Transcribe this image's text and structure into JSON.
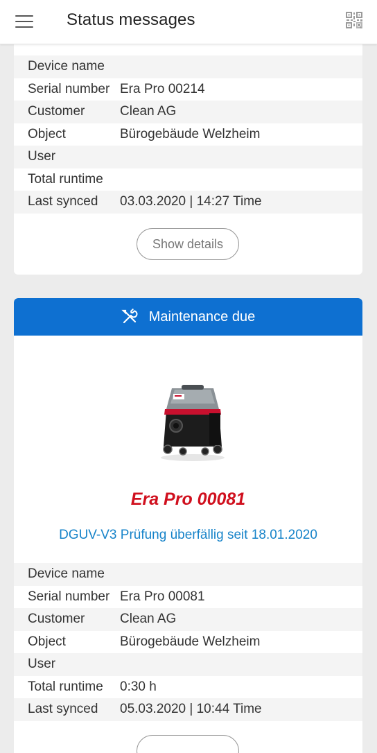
{
  "header": {
    "title": "Status messages",
    "menu_icon": "hamburger-menu-icon",
    "qr_icon": "qr-code-icon"
  },
  "card1": {
    "rows": [
      {
        "label": "Device name",
        "value": ""
      },
      {
        "label": "Serial number",
        "value": "Era Pro 00214"
      },
      {
        "label": "Customer",
        "value": "Clean AG"
      },
      {
        "label": "Object",
        "value": "Bürogebäude Welzheim"
      },
      {
        "label": "User",
        "value": ""
      },
      {
        "label": "Total runtime",
        "value": ""
      },
      {
        "label": "Last synced",
        "value": "03.03.2020 | 14:27 Time"
      }
    ],
    "details_button": "Show details"
  },
  "card2": {
    "banner": {
      "label": "Maintenance due",
      "icon": "tools-icon",
      "color": "#0e70d1"
    },
    "device": {
      "name": "Era Pro 00081",
      "name_color": "#d0101e",
      "message": "DGUV-V3 Prüfung überfällig seit 18.01.2020",
      "message_color": "#1683c9",
      "image": "vacuum-cleaner-image"
    },
    "rows": [
      {
        "label": "Device name",
        "value": ""
      },
      {
        "label": "Serial number",
        "value": "Era Pro 00081"
      },
      {
        "label": "Customer",
        "value": "Clean AG"
      },
      {
        "label": "Object",
        "value": "Bürogebäude Welzheim"
      },
      {
        "label": "User",
        "value": ""
      },
      {
        "label": "Total runtime",
        "value": "0:30 h"
      },
      {
        "label": "Last synced",
        "value": "05.03.2020 | 10:44 Time"
      }
    ]
  }
}
